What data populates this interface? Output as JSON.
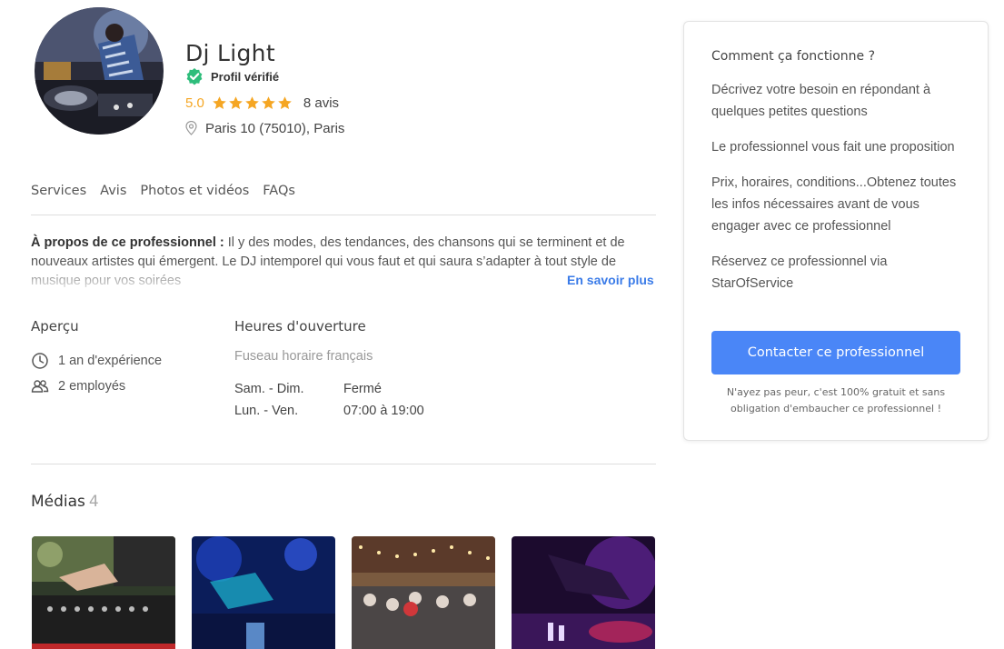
{
  "profile": {
    "name": "Dj Light",
    "verified_label": "Profil vérifié",
    "rating_score": "5.0",
    "rating_stars": 5,
    "reviews_label": "8 avis",
    "location": "Paris 10 (75010), Paris"
  },
  "tabs": [
    "Services",
    "Avis",
    "Photos et vidéos",
    "FAQs"
  ],
  "about": {
    "heading": "À propos de ce professionnel :",
    "text": " Il y des modes, des tendances, des chansons qui se terminent et de nouveaux artistes qui émergent. Le DJ intemporel qui vous faut et qui saura s’adapter à tout style de musique pour vos soirées",
    "more_label": "En savoir plus"
  },
  "apercu": {
    "title": "Aperçu",
    "experience": "1 an d'expérience",
    "employees": "2 employés"
  },
  "hours": {
    "title": "Heures d'ouverture",
    "timezone": "Fuseau horaire français",
    "rows": [
      {
        "days": "Sam. - Dim.",
        "hours": "Fermé"
      },
      {
        "days": "Lun. - Ven.",
        "hours": "07:00 à 19:00"
      }
    ]
  },
  "medias": {
    "title": "Médias",
    "count": "4"
  },
  "how_it_works": {
    "title": "Comment ça fonctionne ?",
    "steps": [
      "Décrivez votre besoin en répondant à quelques petites questions",
      "Le professionnel vous fait une proposition",
      "Prix, horaires, conditions...Obtenez toutes les infos nécessaires avant de vous engager avec ce professionnel",
      "Réservez ce professionnel via StarOfService"
    ],
    "button_label": "Contacter ce professionnel",
    "note": "N'ayez pas peur, c'est 100% gratuit et sans obligation d'embaucher ce professionnel !"
  },
  "colors": {
    "accent": "#4a86f7",
    "link": "#3a7be8",
    "star": "#f5a623",
    "verified": "#2ebd7b"
  },
  "icons": {
    "verified": "check-badge-icon",
    "star": "star-icon",
    "location": "map-pin-icon",
    "experience": "clock-icon",
    "employees": "users-icon"
  }
}
